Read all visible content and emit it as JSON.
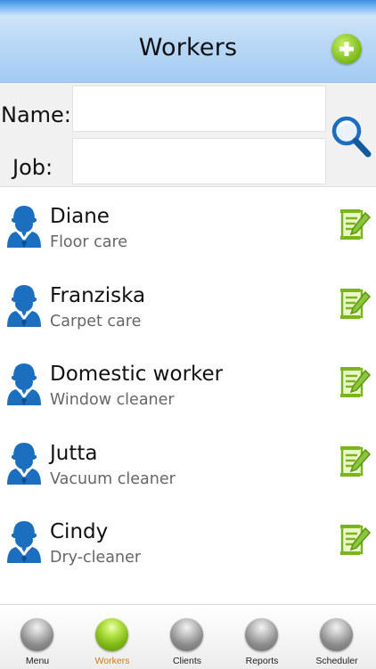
{
  "header": {
    "title": "Workers",
    "add_icon": "add-plus-icon"
  },
  "search": {
    "name_label": "Name:",
    "name_value": "",
    "job_label": "Job:",
    "job_value": "",
    "search_icon": "magnifier-icon"
  },
  "workers": [
    {
      "name": "Diane",
      "job": "Floor care"
    },
    {
      "name": "Franziska",
      "job": "Carpet care"
    },
    {
      "name": "Domestic worker",
      "job": "Window cleaner"
    },
    {
      "name": "Jutta",
      "job": "Vacuum cleaner"
    },
    {
      "name": "Cindy",
      "job": "Dry-cleaner"
    }
  ],
  "tabs": [
    {
      "label": "Menu",
      "active": false
    },
    {
      "label": "Workers",
      "active": true
    },
    {
      "label": "Clients",
      "active": false
    },
    {
      "label": "Reports",
      "active": false
    },
    {
      "label": "Scheduler",
      "active": false
    }
  ],
  "colors": {
    "accent_green": "#7ebc1c",
    "header_blue": "#a4ccf3",
    "icon_blue": "#1c6fbf",
    "active_tab_text": "#c87a1c"
  }
}
